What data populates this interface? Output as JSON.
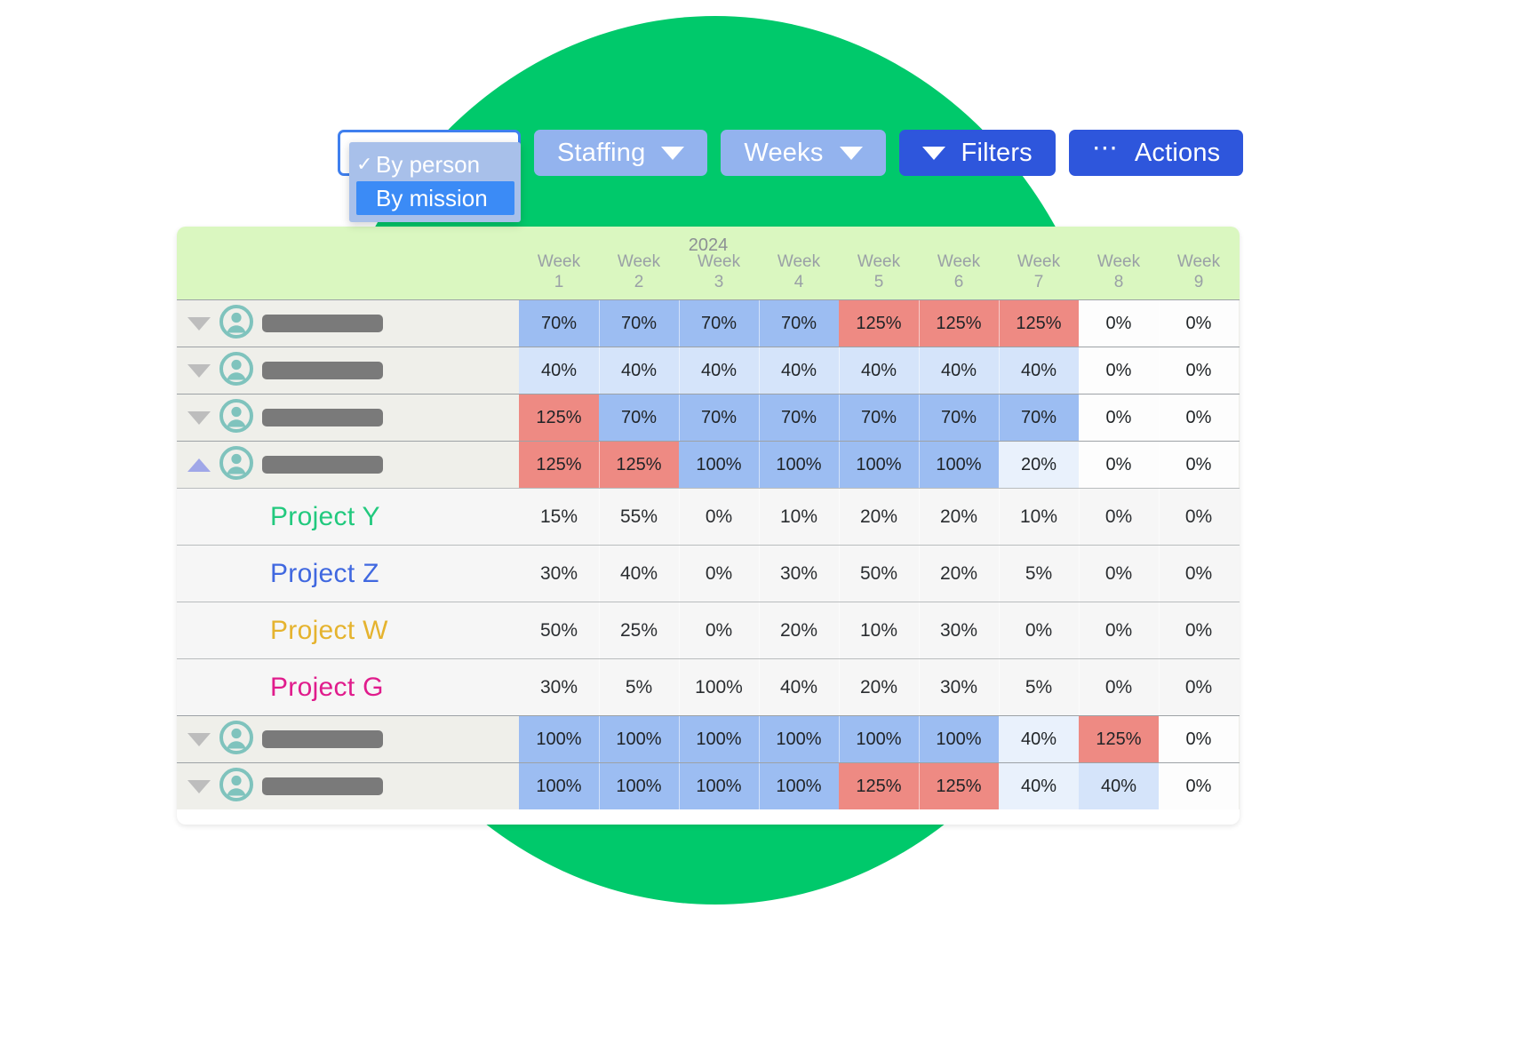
{
  "toolbar": {
    "group_select": {
      "name": "grouping-select",
      "value": "By person",
      "options": [
        {
          "label": "By person",
          "checked": true
        },
        {
          "label": "By mission",
          "checked": false
        }
      ]
    },
    "buttons": [
      {
        "name": "staffing",
        "label": "Staffing",
        "icon": "chevron-down-icon",
        "style": "light"
      },
      {
        "name": "weeks",
        "label": "Weeks",
        "icon": "chevron-down-icon",
        "style": "light"
      },
      {
        "name": "filters",
        "label": "Filters",
        "icon": "chevron-down-icon",
        "style": "solid"
      },
      {
        "name": "actions",
        "label": "Actions",
        "icon": "ellipsis-icon",
        "style": "solid"
      }
    ]
  },
  "table": {
    "year": "2024",
    "week_label": "Week",
    "columns": [
      "1",
      "2",
      "3",
      "4",
      "5",
      "6",
      "7",
      "8",
      "9"
    ],
    "rows": [
      {
        "type": "person",
        "name_redacted": true,
        "expanded": false,
        "toggle_icon": "chevron-down-icon",
        "avatar_icon": "user-avatar-icon",
        "values": [
          "70%",
          "70%",
          "70%",
          "70%",
          "125%",
          "125%",
          "125%",
          "0%",
          "0%"
        ],
        "colors": [
          "blue",
          "blue",
          "blue",
          "blue",
          "red",
          "red",
          "red",
          "white",
          "white"
        ]
      },
      {
        "type": "person",
        "name_redacted": true,
        "expanded": false,
        "toggle_icon": "chevron-down-icon",
        "avatar_icon": "user-avatar-icon",
        "values": [
          "40%",
          "40%",
          "40%",
          "40%",
          "40%",
          "40%",
          "40%",
          "0%",
          "0%"
        ],
        "colors": [
          "blue2",
          "blue2",
          "blue2",
          "blue2",
          "blue2",
          "blue2",
          "blue2",
          "white",
          "white"
        ]
      },
      {
        "type": "person",
        "name_redacted": true,
        "expanded": false,
        "toggle_icon": "chevron-down-icon",
        "avatar_icon": "user-avatar-icon",
        "values": [
          "125%",
          "70%",
          "70%",
          "70%",
          "70%",
          "70%",
          "70%",
          "0%",
          "0%"
        ],
        "colors": [
          "red",
          "blue",
          "blue",
          "blue",
          "blue",
          "blue",
          "blue",
          "white",
          "white"
        ]
      },
      {
        "type": "person",
        "name_redacted": true,
        "expanded": true,
        "toggle_icon": "chevron-up-icon",
        "avatar_icon": "user-avatar-icon",
        "values": [
          "125%",
          "125%",
          "100%",
          "100%",
          "100%",
          "100%",
          "20%",
          "0%",
          "0%"
        ],
        "colors": [
          "red",
          "red",
          "blue",
          "blue",
          "blue",
          "blue",
          "blue3",
          "white",
          "white"
        ]
      },
      {
        "type": "project",
        "label": "Project Y",
        "color": "#22C97E",
        "values": [
          "15%",
          "55%",
          "0%",
          "10%",
          "20%",
          "20%",
          "10%",
          "0%",
          "0%"
        ],
        "colors": [
          "none",
          "none",
          "none",
          "none",
          "none",
          "none",
          "none",
          "none",
          "none"
        ]
      },
      {
        "type": "project",
        "label": "Project Z",
        "color": "#4068E0",
        "values": [
          "30%",
          "40%",
          "0%",
          "30%",
          "50%",
          "20%",
          "5%",
          "0%",
          "0%"
        ],
        "colors": [
          "none",
          "none",
          "none",
          "none",
          "none",
          "none",
          "none",
          "none",
          "none"
        ]
      },
      {
        "type": "project",
        "label": "Project W",
        "color": "#E5B32E",
        "values": [
          "50%",
          "25%",
          "0%",
          "20%",
          "10%",
          "30%",
          "0%",
          "0%",
          "0%"
        ],
        "colors": [
          "none",
          "none",
          "none",
          "none",
          "none",
          "none",
          "none",
          "none",
          "none"
        ]
      },
      {
        "type": "project",
        "label": "Project G",
        "color": "#E01C8C",
        "values": [
          "30%",
          "5%",
          "100%",
          "40%",
          "20%",
          "30%",
          "5%",
          "0%",
          "0%"
        ],
        "colors": [
          "none",
          "none",
          "none",
          "none",
          "none",
          "none",
          "none",
          "none",
          "none"
        ]
      },
      {
        "type": "person",
        "name_redacted": true,
        "expanded": false,
        "toggle_icon": "chevron-down-icon",
        "avatar_icon": "user-avatar-icon",
        "values": [
          "100%",
          "100%",
          "100%",
          "100%",
          "100%",
          "100%",
          "40%",
          "125%",
          "0%"
        ],
        "colors": [
          "blue",
          "blue",
          "blue",
          "blue",
          "blue",
          "blue",
          "blue3",
          "red",
          "white"
        ]
      },
      {
        "type": "person",
        "name_redacted": true,
        "expanded": false,
        "toggle_icon": "chevron-down-icon",
        "avatar_icon": "user-avatar-icon",
        "values": [
          "100%",
          "100%",
          "100%",
          "100%",
          "125%",
          "125%",
          "40%",
          "40%",
          "0%"
        ],
        "colors": [
          "blue",
          "blue",
          "blue",
          "blue",
          "red",
          "red",
          "blue3",
          "blue2",
          "white"
        ]
      }
    ]
  },
  "theme": {
    "background_circle": "#00C96B",
    "header_background": "#DAF7C0",
    "heat_over": "#EE8A83",
    "heat_full": "#9CBDF2",
    "heat_mid": "#D5E4FA",
    "heat_low": "#E9F1FC",
    "button_light": "#93B3EE",
    "button_solid": "#2E56DC"
  }
}
